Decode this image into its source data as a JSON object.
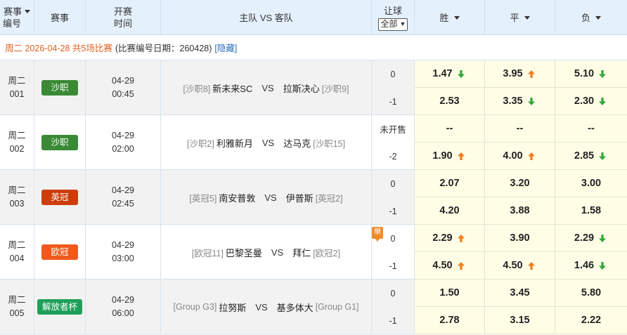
{
  "header": {
    "col_event_no": "赛事\n编号",
    "col_event_no_l1": "赛事",
    "col_event_no_l2": "编号",
    "col_league": "赛事",
    "col_time_l1": "开赛",
    "col_time_l2": "时间",
    "col_teams": "主队 VS 客队",
    "col_handicap_l1": "让球",
    "handicap_select": "全部",
    "col_win": "胜",
    "col_draw": "平",
    "col_lose": "负"
  },
  "info": {
    "date_text": "周二 2026-04-28 共5场比赛",
    "meta_text": "(比赛编号日期：260428)",
    "hide_link": "[隐藏]"
  },
  "colors": {
    "up": "#f07c1a",
    "down": "#2fa83a"
  },
  "matches": [
    {
      "day": "周二",
      "num": "001",
      "league": "沙职",
      "league_color": "#3a8a35",
      "date": "04-29",
      "time": "00:45",
      "home_rank": "[沙职8]",
      "home": "新未来SC",
      "vs": "VS",
      "away": "拉斯决心",
      "away_rank": "[沙职9]",
      "single": "",
      "lines": [
        {
          "hc": "0",
          "odds": [
            {
              "v": "1.47",
              "t": "down"
            },
            {
              "v": "3.95",
              "t": "up"
            },
            {
              "v": "5.10",
              "t": "down"
            }
          ]
        },
        {
          "hc": "-1",
          "odds": [
            {
              "v": "2.53",
              "t": ""
            },
            {
              "v": "3.35",
              "t": "down"
            },
            {
              "v": "2.30",
              "t": "down"
            }
          ]
        }
      ]
    },
    {
      "day": "周二",
      "num": "002",
      "league": "沙职",
      "league_color": "#3a8a35",
      "date": "04-29",
      "time": "02:00",
      "home_rank": "[沙职2]",
      "home": "利雅新月",
      "vs": "VS",
      "away": "达马克",
      "away_rank": "[沙职15]",
      "single": "",
      "lines": [
        {
          "hc": "未开售",
          "odds": [
            {
              "v": "--",
              "t": ""
            },
            {
              "v": "--",
              "t": ""
            },
            {
              "v": "--",
              "t": ""
            }
          ]
        },
        {
          "hc": "-2",
          "odds": [
            {
              "v": "1.90",
              "t": "up"
            },
            {
              "v": "4.00",
              "t": "up"
            },
            {
              "v": "2.85",
              "t": "down"
            }
          ]
        }
      ]
    },
    {
      "day": "周二",
      "num": "003",
      "league": "英冠",
      "league_color": "#cc3d0a",
      "date": "04-29",
      "time": "02:45",
      "home_rank": "[英冠5]",
      "home": "南安普敦",
      "vs": "VS",
      "away": "伊普斯",
      "away_rank": "[英冠2]",
      "single": "",
      "lines": [
        {
          "hc": "0",
          "odds": [
            {
              "v": "2.07",
              "t": ""
            },
            {
              "v": "3.20",
              "t": ""
            },
            {
              "v": "3.00",
              "t": ""
            }
          ]
        },
        {
          "hc": "-1",
          "odds": [
            {
              "v": "4.20",
              "t": ""
            },
            {
              "v": "3.88",
              "t": ""
            },
            {
              "v": "1.58",
              "t": ""
            }
          ]
        }
      ]
    },
    {
      "day": "周二",
      "num": "004",
      "league": "欧冠",
      "league_color": "#f05a1c",
      "date": "04-29",
      "time": "03:00",
      "home_rank": "[欧冠11]",
      "home": "巴黎圣曼",
      "vs": "VS",
      "away": "拜仁",
      "away_rank": "[欧冠2]",
      "single": "单",
      "lines": [
        {
          "hc": "0",
          "odds": [
            {
              "v": "2.29",
              "t": "up"
            },
            {
              "v": "3.90",
              "t": ""
            },
            {
              "v": "2.29",
              "t": "down"
            }
          ]
        },
        {
          "hc": "-1",
          "odds": [
            {
              "v": "4.50",
              "t": "up"
            },
            {
              "v": "4.50",
              "t": "up"
            },
            {
              "v": "1.46",
              "t": "down"
            }
          ]
        }
      ]
    },
    {
      "day": "周二",
      "num": "005",
      "league": "解放者杯",
      "league_color": "#1ea05a",
      "date": "04-29",
      "time": "06:00",
      "home_rank": "[Group G3]",
      "home": "拉努斯",
      "vs": "VS",
      "away": "基多体大",
      "away_rank": "[Group G1]",
      "single": "",
      "lines": [
        {
          "hc": "0",
          "odds": [
            {
              "v": "1.50",
              "t": ""
            },
            {
              "v": "3.45",
              "t": ""
            },
            {
              "v": "5.80",
              "t": ""
            }
          ]
        },
        {
          "hc": "-1",
          "odds": [
            {
              "v": "2.78",
              "t": ""
            },
            {
              "v": "3.15",
              "t": ""
            },
            {
              "v": "2.22",
              "t": ""
            }
          ]
        }
      ]
    }
  ]
}
